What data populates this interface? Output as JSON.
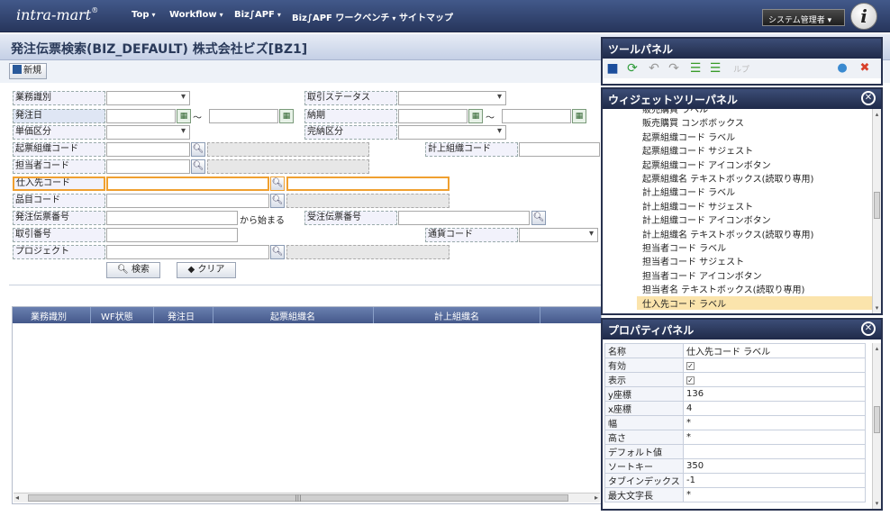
{
  "header": {
    "logo": "intra-mart",
    "nav": [
      "Top",
      "Workflow",
      "Biz∫APF",
      "Biz∫APF ワークベンチ",
      "サイトマップ"
    ],
    "user": "システム管理者"
  },
  "page": {
    "title": "発注伝票検索(BIZ_DEFAULT) 株式会社ビズ[BZ1]",
    "new_button": "新規"
  },
  "form": {
    "gyomu": "業務識別",
    "torihiki_status": "取引ステータス",
    "hacchubi": "発注日",
    "noki": "納期",
    "tilde": "～",
    "tanka_kubun": "単価区分",
    "kanno_kubun": "完納区分",
    "kihyo_code": "起票組織コード",
    "keijo_code": "計上組織コード",
    "tanto_code": "担当者コード",
    "shiire_code": "仕入先コード",
    "hinmoku_code": "品目コード",
    "hacchu_no": "発注伝票番号",
    "kara_hajimaru": "から始まる",
    "juchu_no": "受注伝票番号",
    "torihiki_no": "取引番号",
    "tsuka_code": "通貨コード",
    "project": "プロジェクト",
    "search_button": "検索",
    "clear_button": "クリア"
  },
  "grid": {
    "columns": [
      "業務識別",
      "WF状態",
      "発注日",
      "起票組織名",
      "計上組織名"
    ]
  },
  "tool_panel": {
    "title": "ツールパネル",
    "faded_text": "ルプ"
  },
  "widget_panel": {
    "title": "ウィジェットツリーパネル",
    "items": [
      "販売購買 ラベル",
      "販売購買 コンボボックス",
      "起票組織コード ラベル",
      "起票組織コード サジェスト",
      "起票組織コード アイコンボタン",
      "起票組織名 テキストボックス(読取り専用)",
      "計上組織コード ラベル",
      "計上組織コード サジェスト",
      "計上組織コード アイコンボタン",
      "計上組織名 テキストボックス(読取り専用)",
      "担当者コード ラベル",
      "担当者コード サジェスト",
      "担当者コード アイコンボタン",
      "担当者名 テキストボックス(読取り専用)",
      "仕入先コード ラベル"
    ],
    "selected_index": 14
  },
  "property_panel": {
    "title": "プロパティパネル",
    "rows": [
      {
        "key": "名称",
        "value": "仕入先コード ラベル"
      },
      {
        "key": "有効",
        "value": "✓",
        "checkbox": true
      },
      {
        "key": "表示",
        "value": "✓",
        "checkbox": true
      },
      {
        "key": "y座標",
        "value": "136"
      },
      {
        "key": "x座標",
        "value": "4"
      },
      {
        "key": "幅",
        "value": "*"
      },
      {
        "key": "高さ",
        "value": "*"
      },
      {
        "key": "デフォルト値",
        "value": ""
      },
      {
        "key": "ソートキー",
        "value": "350"
      },
      {
        "key": "タブインデックス",
        "value": "-1"
      },
      {
        "key": "最大文字長",
        "value": "*"
      }
    ]
  },
  "colors": {
    "topbar": "#2d3d66",
    "panel_header": "#26324f",
    "selection_outline": "#f0a030",
    "tree_highlight": "#fbe4ac"
  },
  "icons": [
    "save-icon",
    "refresh-icon",
    "undo-icon",
    "redo-icon",
    "align-left-icon",
    "align-right-icon",
    "help-icon",
    "close-icon",
    "search-icon",
    "calendar-icon",
    "clear-icon"
  ]
}
